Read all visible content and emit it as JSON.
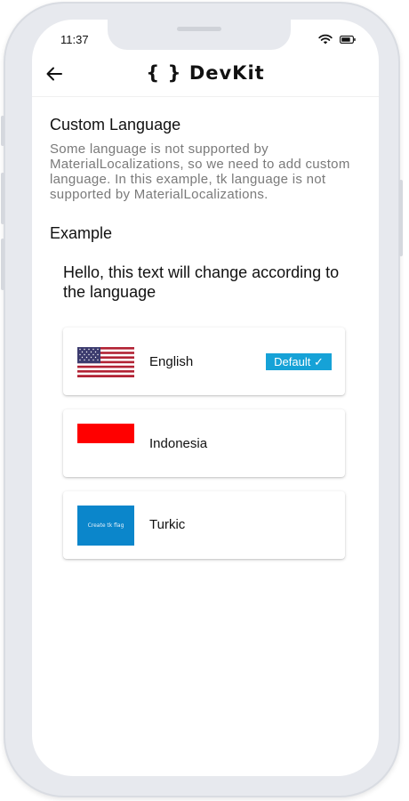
{
  "status_bar": {
    "time": "11:37",
    "icons": [
      "wifi-icon",
      "battery-icon"
    ]
  },
  "app_bar": {
    "back_icon": "arrow-back-icon",
    "title": "{ } DevKit"
  },
  "content": {
    "section_title": "Custom Language",
    "description": "Some language is not supported by MaterialLocalizations, so we need to add custom language. In this example, tk language is not supported by MaterialLocalizations.",
    "example_title": "Example",
    "example_text": "Hello, this text will change according to the language"
  },
  "languages": [
    {
      "label": "English",
      "flag": "us-flag-icon",
      "badge": "Default ✓"
    },
    {
      "label": "Indonesia",
      "flag": "indonesia-flag-icon"
    },
    {
      "label": "Turkic",
      "flag": "turkic-flag-placeholder",
      "flag_text": "Create tk flag"
    }
  ],
  "colors": {
    "accent": "#16a2d7",
    "text_primary": "#111111",
    "text_secondary": "#7a7a7a",
    "flag_red": "#ff0000",
    "flag_blue": "#0b86cb"
  }
}
